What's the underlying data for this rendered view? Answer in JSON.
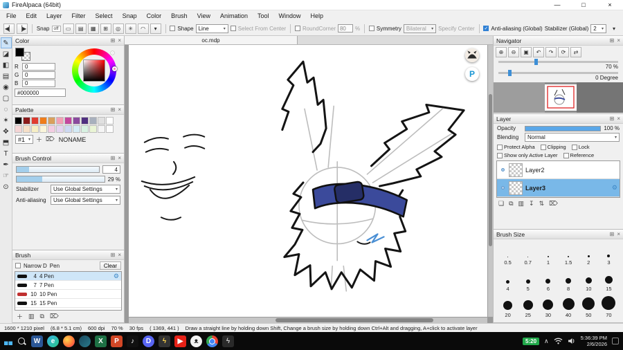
{
  "ui": {
    "caret": "▾",
    "pin": "⊞",
    "close": "×",
    "gear": "⚙",
    "min": "—",
    "max": "□",
    "x": "×",
    "chevron_up": "∧",
    "prev": "◀▏",
    "next": "▕▶",
    "sep": "|"
  },
  "window": {
    "title": "FireAlpaca (64bit)"
  },
  "menu": [
    "File",
    "Edit",
    "Layer",
    "Filter",
    "Select",
    "Snap",
    "Color",
    "Brush",
    "View",
    "Animation",
    "Tool",
    "Window",
    "Help"
  ],
  "toolbar": {
    "snap_label": "Snap",
    "snap_off": "off",
    "snap_icons": [
      {
        "name": "snap-parallel-icon",
        "glyph": "▭"
      },
      {
        "name": "snap-horizontal-icon",
        "glyph": "▤"
      },
      {
        "name": "snap-grid-icon",
        "glyph": "▦"
      },
      {
        "name": "snap-cross-icon",
        "glyph": "⊞"
      },
      {
        "name": "snap-circle-icon",
        "glyph": "◎"
      },
      {
        "name": "snap-radial-icon",
        "glyph": "✳"
      },
      {
        "name": "snap-curve-icon",
        "glyph": "◠"
      },
      {
        "name": "snap-config-icon",
        "glyph": "▾"
      }
    ],
    "shape_label": "Shape",
    "shape_value": "Line",
    "select_from_center": "Select From Center",
    "round_corner_label": "RoundCorner",
    "round_corner_value": "80",
    "percent_label": "%",
    "symmetry_label": "Symmetry",
    "symmetry_value": "Bilateral",
    "specify_center": "Specify Center",
    "anti_aliasing": "Anti-aliasing (Global)",
    "stabilizer_label": "Stabilizer (Global)",
    "stabilizer_value": "2"
  },
  "tools": [
    {
      "name": "tool-pen",
      "glyph": "✎",
      "active": true
    },
    {
      "name": "tool-eraser",
      "glyph": "◪"
    },
    {
      "name": "tool-bucket",
      "glyph": "◧"
    },
    {
      "name": "tool-gradient",
      "glyph": "▤"
    },
    {
      "name": "tool-dot-pen",
      "glyph": "◉"
    },
    {
      "name": "tool-select-rect",
      "glyph": "▢"
    },
    {
      "name": "tool-lasso",
      "glyph": "◌"
    },
    {
      "name": "tool-magic-wand",
      "glyph": "✶"
    },
    {
      "name": "tool-move",
      "glyph": "✥"
    },
    {
      "name": "tool-transform",
      "glyph": "⬒"
    },
    {
      "name": "tool-text",
      "glyph": "T"
    },
    {
      "name": "tool-eyedropper",
      "glyph": "✒"
    },
    {
      "name": "tool-hand",
      "glyph": "☞"
    },
    {
      "name": "tool-zoom",
      "glyph": "⊙"
    }
  ],
  "color_panel": {
    "title": "Color",
    "rows": [
      {
        "label": "R",
        "value": "0"
      },
      {
        "label": "G",
        "value": "0"
      },
      {
        "label": "B",
        "value": "0"
      }
    ],
    "hex": "#000000"
  },
  "palette_panel": {
    "title": "Palette",
    "page": "#1",
    "name": "NONAME",
    "swatches": [
      "#000000",
      "#8b1a1a",
      "#e03c31",
      "#ef7d1a",
      "#d9a05c",
      "#f2a0b4",
      "#c4489e",
      "#8a4a9e",
      "#503080",
      "#a8b0bd",
      "#e0e0e0",
      "#ffffff",
      "#f5d5d5",
      "#f7e0c8",
      "#f7efc5",
      "#faf5da",
      "#f3cde2",
      "#e4d4f0",
      "#cdd9f2",
      "#d4ebf5",
      "#d8f2e2",
      "#eaf5d5",
      "#f5f5f5",
      "#fdfdfd"
    ],
    "actions": [
      {
        "name": "add-palette-icon",
        "glyph": "＋"
      },
      {
        "name": "delete-palette-icon",
        "glyph": "⌦"
      }
    ]
  },
  "brush_control": {
    "title": "Brush Control",
    "size_value": "4",
    "size_fill": "15%",
    "opacity_value": "29 %",
    "opacity_fill": "29%",
    "stabilizer_label": "Stabilizer",
    "stabilizer_value": "Use Global Settings",
    "antialias_label": "Anti-aliasing",
    "antialias_value": "Use Global Settings"
  },
  "brush_panel": {
    "title": "Brush",
    "narrow_label": "Narrow D",
    "type_label": "Pen",
    "clear_label": "Clear",
    "items": [
      {
        "size": "4",
        "name": "4 Pen",
        "color": "#111111",
        "selected": true
      },
      {
        "size": "7",
        "name": "7 Pen",
        "color": "#111111"
      },
      {
        "size": "10",
        "name": "10 Pen",
        "color": "#c03030"
      },
      {
        "size": "15",
        "name": "15 Pen",
        "color": "#111111"
      }
    ],
    "actions": [
      {
        "name": "add-brush-icon",
        "glyph": "＋"
      },
      {
        "name": "brush-folder-icon",
        "glyph": "▥"
      },
      {
        "name": "duplicate-brush-icon",
        "glyph": "⧉"
      },
      {
        "name": "delete-brush-icon",
        "glyph": "⌦"
      }
    ]
  },
  "canvas": {
    "tab": "oc.mdp",
    "overlay_p": "P"
  },
  "navigator": {
    "title": "Navigator",
    "buttons": [
      {
        "name": "zoom-in-icon",
        "glyph": "⊕"
      },
      {
        "name": "zoom-out-icon",
        "glyph": "⊖"
      },
      {
        "name": "fit-window-icon",
        "glyph": "▣"
      },
      {
        "name": "rotate-ccw-icon",
        "glyph": "↶"
      },
      {
        "name": "rotate-cw-icon",
        "glyph": "↷"
      },
      {
        "name": "reset-view-icon",
        "glyph": "⟳"
      },
      {
        "name": "flip-view-icon",
        "glyph": "⇄"
      }
    ],
    "zoom": "70 %",
    "rotation": "0 Degree"
  },
  "layer_panel": {
    "title": "Layer",
    "opacity_label": "Opacity",
    "opacity_value": "100 %",
    "blending_label": "Blending",
    "blending_value": "Normal",
    "cb1": [
      "Protect Alpha",
      "Clipping",
      "Lock"
    ],
    "cb2": [
      "Show only Active Layer",
      "Reference"
    ],
    "layers": [
      {
        "name": "Layer2"
      },
      {
        "name": "Layer3",
        "selected": true
      }
    ],
    "actions": [
      {
        "name": "new-layer-icon",
        "glyph": "❏"
      },
      {
        "name": "duplicate-layer-icon",
        "glyph": "⧉"
      },
      {
        "name": "new-folder-icon",
        "glyph": "▥"
      },
      {
        "name": "merge-down-icon",
        "glyph": "↧"
      },
      {
        "name": "reorder-layer-icon",
        "glyph": "⇅"
      },
      {
        "name": "delete-layer-icon",
        "glyph": "⌦"
      }
    ]
  },
  "brush_size": {
    "title": "Brush Size",
    "items": [
      {
        "label": "0.5",
        "dot": "1px"
      },
      {
        "label": "0.7",
        "dot": "1px"
      },
      {
        "label": "1",
        "dot": "2px"
      },
      {
        "label": "1.5",
        "dot": "2px"
      },
      {
        "label": "2",
        "dot": "3px"
      },
      {
        "label": "3",
        "dot": "4px"
      },
      {
        "label": "4",
        "dot": "5px"
      },
      {
        "label": "5",
        "dot": "6px"
      },
      {
        "label": "6",
        "dot": "7px"
      },
      {
        "label": "8",
        "dot": "8px"
      },
      {
        "label": "10",
        "dot": "9px"
      },
      {
        "label": "15",
        "dot": "11px"
      },
      {
        "label": "20",
        "dot": "13px"
      },
      {
        "label": "25",
        "dot": "14px"
      },
      {
        "label": "30",
        "dot": "15px"
      },
      {
        "label": "40",
        "dot": "17px"
      },
      {
        "label": "50",
        "dot": "18px"
      },
      {
        "label": "70",
        "dot": "20px"
      }
    ]
  },
  "status": {
    "doc": "1600 * 1210 pixel",
    "cm": "(6.8 * 5.1 cm)",
    "dpi": "600 dpi",
    "zoom": "70 %",
    "fps": "30 fps",
    "coords": "( 1369, 441 )",
    "hint": "Draw a straight line by holding down Shift, Change a brush size by holding down Ctrl+Alt and dragging, A+click to activate layer"
  },
  "taskbar": {
    "badge": "5:20",
    "time": "5:36:39 PM",
    "date": "2/6/2026",
    "apps": [
      {
        "name": "word-icon",
        "glyph": "W",
        "bg": "#2b5797",
        "fg": "#ffffff"
      },
      {
        "name": "edge-icon",
        "glyph": "e",
        "bg": "linear-gradient(135deg,#35b4e0,#2bc48a)",
        "fg": "#ffffff",
        "cls": "round"
      },
      {
        "name": "firefox-icon",
        "glyph": "",
        "bg": "radial-gradient(circle at 35% 35%,#ffd54d,#ff7139 60%,#e3336d)",
        "cls": "round"
      },
      {
        "name": "obs-icon",
        "glyph": "",
        "bg": "linear-gradient(135deg,#18475c,#2a7a8c)",
        "cls": "round"
      },
      {
        "name": "excel-icon",
        "glyph": "X",
        "bg": "#1e7145",
        "fg": "#ffffff"
      },
      {
        "name": "powerpoint-icon",
        "glyph": "P",
        "bg": "#d24726",
        "fg": "#ffffff"
      },
      {
        "name": "tiktok-icon",
        "glyph": "♪",
        "bg": "#111111",
        "fg": "#ffffff"
      },
      {
        "name": "discord-icon",
        "glyph": "D",
        "bg": "#5865f2",
        "fg": "#ffffff",
        "cls": "round"
      },
      {
        "name": "lightning-icon",
        "glyph": "ϟ",
        "bg": "#333333",
        "fg": "#ffd34d"
      },
      {
        "name": "youtube-icon",
        "glyph": "▶",
        "bg": "#e62117",
        "fg": "#ffffff"
      },
      {
        "name": "firealpaca-icon",
        "glyph": "ᴥ",
        "bg": "#f4f4f4",
        "fg": "#222222",
        "cls": "round"
      },
      {
        "name": "chrome-icon",
        "glyph": "",
        "bg": "conic-gradient(#ea4335 0 33%,#4285f4 33% 66%,#34a853 66% 100%)",
        "cls": "round chrome"
      },
      {
        "name": "lightning2-icon",
        "glyph": "ϟ",
        "bg": "#2a2a2a",
        "fg": "#cccccc"
      }
    ]
  },
  "colors": {
    "accent": "#3d9be9",
    "layer_selected": "#79b8e8",
    "band_blue": "#3b4a9b",
    "workspace": "#9a9a9a",
    "taskbar": "#0a0a0a"
  }
}
